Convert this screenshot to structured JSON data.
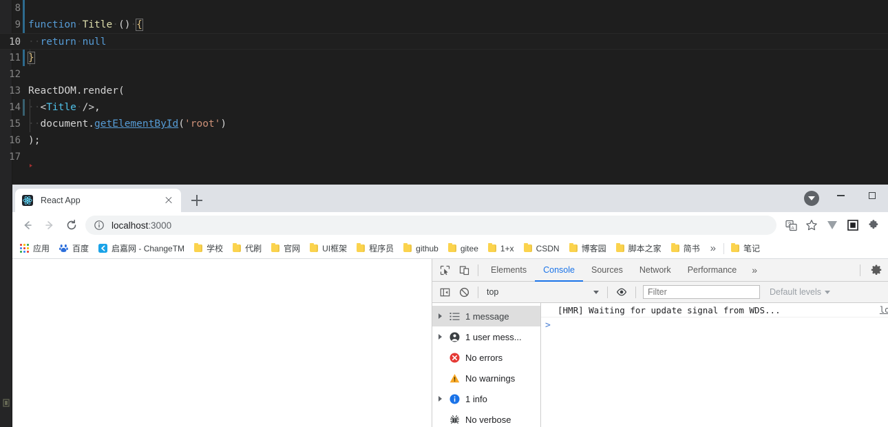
{
  "editor": {
    "theme_bg": "#1e1e1e",
    "lines": [
      {
        "num": "8",
        "tokens": []
      },
      {
        "num": "9",
        "tokens": [
          {
            "t": "function",
            "c": "tok-kw"
          },
          {
            "t": "·",
            "c": "ws"
          },
          {
            "t": "Title",
            "c": "tok-fn"
          },
          {
            "t": "·",
            "c": "ws"
          },
          {
            "t": "()",
            "c": "tok-punc"
          },
          {
            "t": "·",
            "c": "ws"
          },
          {
            "t": "{",
            "c": "tok-brace bracket-box"
          }
        ]
      },
      {
        "num": "10",
        "tokens": [
          {
            "t": "··",
            "c": "ws"
          },
          {
            "t": "return",
            "c": "tok-kw"
          },
          {
            "t": "·",
            "c": "ws"
          },
          {
            "t": "null",
            "c": "tok-kw"
          }
        ]
      },
      {
        "num": "11",
        "tokens": [
          {
            "t": "}",
            "c": "tok-brace bracket-box"
          }
        ]
      },
      {
        "num": "12",
        "tokens": []
      },
      {
        "num": "13",
        "tokens": [
          {
            "t": "ReactDOM.render(",
            "c": "tok-plain"
          }
        ]
      },
      {
        "num": "14",
        "tokens": [
          {
            "t": "··",
            "c": "ws"
          },
          {
            "t": "<",
            "c": "tok-punc"
          },
          {
            "t": "Title",
            "c": "tok-type"
          },
          {
            "t": "·",
            "c": "ws"
          },
          {
            "t": "/>,",
            "c": "tok-punc"
          }
        ]
      },
      {
        "num": "15",
        "tokens": [
          {
            "t": "··",
            "c": "ws"
          },
          {
            "t": "document.",
            "c": "tok-plain"
          },
          {
            "t": "getElementById",
            "c": "tok-link"
          },
          {
            "t": "(",
            "c": "tok-punc"
          },
          {
            "t": "'root'",
            "c": "tok-str"
          },
          {
            "t": ")",
            "c": "tok-punc"
          }
        ]
      },
      {
        "num": "16",
        "tokens": [
          {
            "t": ");",
            "c": "tok-punc"
          }
        ]
      },
      {
        "num": "17",
        "tokens": []
      }
    ]
  },
  "browser": {
    "tab": {
      "title": "React App",
      "favicon_name": "react-favicon",
      "close_name": "tab-close-button"
    },
    "new_tab_label": "+",
    "window_controls": {
      "minimize": "minimize",
      "maximize": "maximize"
    },
    "toolbar": {
      "back": "back",
      "forward": "forward",
      "reload": "reload",
      "url_host": "localhost",
      "url_port": ":3000",
      "site_info": "info-icon",
      "translate": "translate-icon",
      "bookmark_star": "star-icon",
      "extensions": "puzzle-icon"
    },
    "bookmarks": [
      {
        "label": "应用",
        "icon": "apps-grid"
      },
      {
        "label": "百度",
        "icon": "baidu"
      },
      {
        "label": "启嘉网 - ChangeTM",
        "icon": "changetm"
      },
      {
        "label": "学校",
        "icon": "folder"
      },
      {
        "label": "代刷",
        "icon": "folder"
      },
      {
        "label": "官网",
        "icon": "folder"
      },
      {
        "label": "UI框架",
        "icon": "folder"
      },
      {
        "label": "程序员",
        "icon": "folder"
      },
      {
        "label": "github",
        "icon": "folder"
      },
      {
        "label": "gitee",
        "icon": "folder"
      },
      {
        "label": "1+x",
        "icon": "folder"
      },
      {
        "label": "CSDN",
        "icon": "folder"
      },
      {
        "label": "博客园",
        "icon": "folder"
      },
      {
        "label": "脚本之家",
        "icon": "folder"
      },
      {
        "label": "简书",
        "icon": "folder"
      },
      {
        "label": "笔记",
        "icon": "folder"
      }
    ],
    "bookmarks_overflow": "»"
  },
  "devtools": {
    "tabs": [
      {
        "label": "Elements",
        "active": false
      },
      {
        "label": "Console",
        "active": true
      },
      {
        "label": "Sources",
        "active": false
      },
      {
        "label": "Network",
        "active": false
      },
      {
        "label": "Performance",
        "active": false
      }
    ],
    "more_tabs": "»",
    "settings_icon": "gear-icon",
    "inspect_icon": "inspect-icon",
    "device_toolbar_icon": "device-toolbar-icon",
    "filterbar": {
      "sidebar_toggle_icon": "console-sidebar-toggle-icon",
      "clear_icon": "clear-console-icon",
      "context": "top",
      "eye_icon": "live-expression-icon",
      "filter_value": "",
      "filter_placeholder": "Filter",
      "levels": "Default levels"
    },
    "sidebar": [
      {
        "label": "1 message",
        "icon": "list-icon",
        "arrow": true,
        "selected": true,
        "color": "#5f6368"
      },
      {
        "label": "1 user mess...",
        "icon": "user-icon",
        "arrow": true,
        "selected": false,
        "color": "#3c4043"
      },
      {
        "label": "No errors",
        "icon": "error-icon",
        "arrow": false,
        "selected": false,
        "color": "#e53935"
      },
      {
        "label": "No warnings",
        "icon": "warning-icon",
        "arrow": false,
        "selected": false,
        "color": "#f9a825"
      },
      {
        "label": "1 info",
        "icon": "info-icon",
        "arrow": true,
        "selected": false,
        "color": "#1a73e8"
      },
      {
        "label": "No verbose",
        "icon": "verbose-icon",
        "arrow": false,
        "selected": false,
        "color": "#3c4043"
      }
    ],
    "console": {
      "messages": [
        {
          "text": "[HMR] Waiting for update signal from WDS...",
          "source": "log.j"
        }
      ],
      "prompt": ">"
    }
  },
  "colors": {
    "accent_blue": "#1a73e8",
    "tabstrip_bg": "#dee1e6",
    "bookmark_folder": "#fbd34d",
    "editor_bg": "#1e1e1e"
  }
}
